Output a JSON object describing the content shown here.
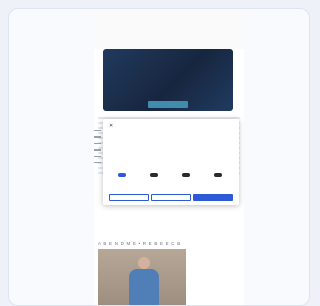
{
  "hero": {
    "title": "",
    "button_label": ""
  },
  "section": {
    "label": "A B E  N D M E  •  R E B E E C B"
  },
  "consent": {
    "close_symbol": "✕",
    "brand": "",
    "title": "",
    "body": "",
    "toggles": [
      {
        "label": "",
        "on": true
      },
      {
        "label": "",
        "on": false
      },
      {
        "label": "",
        "on": false
      },
      {
        "label": "",
        "on": false
      }
    ],
    "details_link": "",
    "deny_label": "",
    "selection_label": "",
    "accept_label": ""
  },
  "colors": {
    "accent": "#2d5ad6",
    "hero": "#1c2f4d",
    "hero_button": "#3f8cab"
  }
}
